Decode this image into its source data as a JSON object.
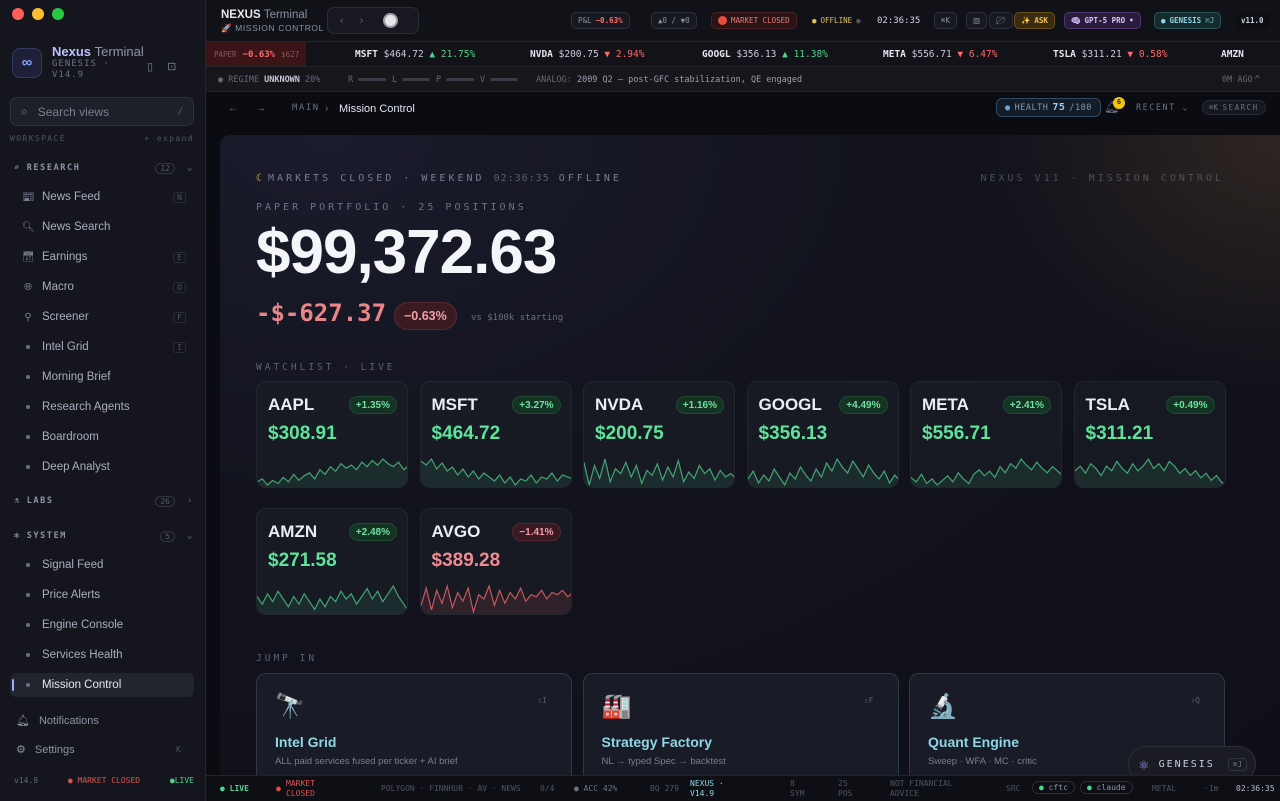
{
  "sidebar": {
    "brand_name": "Nexus",
    "brand_name2": "Terminal",
    "brand_sub1": "GENESIS ·",
    "brand_sub2": "V14.9",
    "search_placeholder": "Search views",
    "search_kbd": "/",
    "workspace_label": "WORKSPACE",
    "expand_label": "+ expand",
    "research": {
      "label": "RESEARCH",
      "count": "12"
    },
    "research_items": [
      {
        "label": "News Feed",
        "sc": "N"
      },
      {
        "label": "News Search",
        "sc": ""
      },
      {
        "label": "Earnings",
        "sc": "E"
      },
      {
        "label": "Macro",
        "sc": "O"
      },
      {
        "label": "Screener",
        "sc": "F"
      },
      {
        "label": "Intel Grid",
        "sc": "I"
      },
      {
        "label": "Morning Brief",
        "sc": ""
      },
      {
        "label": "Research Agents",
        "sc": ""
      },
      {
        "label": "Boardroom",
        "sc": ""
      },
      {
        "label": "Deep Analyst",
        "sc": ""
      }
    ],
    "labs": {
      "label": "LABS",
      "count": "26"
    },
    "system": {
      "label": "SYSTEM",
      "count": "5"
    },
    "system_items": [
      {
        "label": "Signal Feed"
      },
      {
        "label": "Price Alerts"
      },
      {
        "label": "Engine Console"
      },
      {
        "label": "Services Health"
      },
      {
        "label": "Mission Control"
      }
    ],
    "notifications": "Notifications",
    "settings": "Settings",
    "settings_sc": "K",
    "footer_version": "v14.9",
    "footer_market": "MARKET CLOSED",
    "footer_live": "LIVE"
  },
  "topbar": {
    "title": "NEXUS",
    "title2": "Terminal",
    "subtitle": "MISSION CONTROL",
    "pnl_label": "P&L",
    "pnl_value": "−0.63%",
    "counts": "▲0 / ▼0",
    "market": "MARKET CLOSED",
    "offline": "OFFLINE",
    "time": "02:36:35",
    "kbd": "⌘K",
    "ask": "ASK",
    "model": "GPT-5 PRO",
    "genesis": "GENESIS",
    "genesis_kbd": "⌘J",
    "version": "v11.0"
  },
  "ticker": {
    "paper_label": "PAPER",
    "paper_value": "−0.63%",
    "paper_amount": "$627",
    "items": [
      {
        "sym": "MSFT",
        "price": "$464.72",
        "chg": "▲ 21.75%",
        "dir": "up"
      },
      {
        "sym": "NVDA",
        "price": "$200.75",
        "chg": "▼ 2.94%",
        "dir": "dn"
      },
      {
        "sym": "GOOGL",
        "price": "$356.13",
        "chg": "▲ 11.38%",
        "dir": "up"
      },
      {
        "sym": "META",
        "price": "$556.71",
        "chg": "▼ 6.47%",
        "dir": "dn"
      },
      {
        "sym": "TSLA",
        "price": "$311.21",
        "chg": "▼ 0.58%",
        "dir": "dn"
      },
      {
        "sym": "AMZN",
        "price": "",
        "chg": "",
        "dir": "up"
      }
    ]
  },
  "regime": {
    "label": "REGIME",
    "value": "UNKNOWN",
    "pct": "20%",
    "r": "R",
    "l": "L",
    "p": "P",
    "v": "V",
    "analog_label": "ANALOG:",
    "analog": "2009 Q2 — post-GFC stabilization, QE engaged",
    "ago": "0M AGO"
  },
  "crumb": {
    "main": "MAIN",
    "sep": "›",
    "current": "Mission Control",
    "health_label": "HEALTH",
    "health_value": "75",
    "health_max": "/100",
    "bell_count": "6",
    "recent": "RECENT",
    "search_kbd": "⌘K",
    "search": "SEARCH"
  },
  "main": {
    "status": "MARKETS CLOSED · WEEKEND",
    "status_time": "02:36:35",
    "status_offline": "OFFLINE",
    "version": "NEXUS V11 · MISSION CONTROL",
    "portfolio_label": "PAPER PORTFOLIO · 25 POSITIONS",
    "portfolio_value": "$99,372.63",
    "pnl": "-$-627.37",
    "pnl_pct": "−0.63%",
    "vs": "vs $100k starting",
    "watchlist_label": "WATCHLIST · LIVE",
    "jump_label": "JUMP IN"
  },
  "watchlist": [
    {
      "sym": "AAPL",
      "chg": "+1.35%",
      "price": "$308.91",
      "dir": "up",
      "spark": [
        30,
        32,
        28,
        31,
        29,
        33,
        30,
        35,
        31,
        34,
        36,
        32,
        38,
        35,
        40,
        37,
        42,
        39,
        41,
        38,
        43,
        40,
        44,
        41,
        45,
        42,
        40,
        43,
        38,
        41
      ]
    },
    {
      "sym": "MSFT",
      "chg": "+3.27%",
      "price": "$464.72",
      "dir": "up",
      "spark": [
        38,
        36,
        39,
        34,
        37,
        33,
        35,
        31,
        34,
        30,
        33,
        29,
        32,
        30,
        28,
        31,
        27,
        30,
        26,
        29,
        28,
        31,
        27,
        30,
        29,
        32,
        28,
        31,
        30,
        29
      ]
    },
    {
      "sym": "NVDA",
      "chg": "+1.16%",
      "price": "$200.75",
      "dir": "up",
      "spark": [
        40,
        26,
        38,
        30,
        42,
        28,
        36,
        33,
        40,
        31,
        38,
        27,
        35,
        32,
        39,
        29,
        37,
        31,
        41,
        28,
        34,
        30,
        38,
        33,
        36,
        29,
        35,
        31,
        33,
        30
      ]
    },
    {
      "sym": "GOOGL",
      "chg": "+4.49%",
      "price": "$356.13",
      "dir": "up",
      "spark": [
        30,
        34,
        28,
        32,
        29,
        35,
        31,
        27,
        33,
        30,
        36,
        32,
        29,
        35,
        31,
        38,
        34,
        40,
        36,
        33,
        39,
        35,
        31,
        37,
        33,
        30,
        34,
        28,
        32,
        29
      ]
    },
    {
      "sym": "META",
      "chg": "+2.41%",
      "price": "$556.71",
      "dir": "up",
      "spark": [
        32,
        29,
        34,
        28,
        31,
        27,
        30,
        33,
        29,
        35,
        31,
        28,
        34,
        37,
        33,
        36,
        32,
        39,
        35,
        41,
        38,
        44,
        40,
        37,
        42,
        38,
        35,
        39,
        36,
        33
      ]
    },
    {
      "sym": "TSLA",
      "chg": "+0.49%",
      "price": "$311.21",
      "dir": "up",
      "spark": [
        36,
        38,
        35,
        39,
        37,
        34,
        38,
        36,
        40,
        37,
        35,
        39,
        36,
        38,
        41,
        37,
        39,
        36,
        40,
        38,
        35,
        37,
        34,
        36,
        33,
        35,
        32,
        34,
        31,
        30
      ]
    },
    {
      "sym": "AMZN",
      "chg": "+2.48%",
      "price": "$271.58",
      "dir": "up",
      "spark": [
        34,
        31,
        35,
        32,
        36,
        33,
        30,
        34,
        31,
        35,
        32,
        29,
        33,
        30,
        34,
        32,
        36,
        33,
        35,
        31,
        34,
        37,
        33,
        36,
        32,
        35,
        38,
        34,
        31,
        28
      ]
    },
    {
      "sym": "AVGO",
      "chg": "−1.41%",
      "price": "$389.28",
      "dir": "dn",
      "spark": [
        24,
        40,
        20,
        38,
        26,
        42,
        22,
        36,
        28,
        40,
        18,
        34,
        30,
        42,
        24,
        38,
        26,
        36,
        30,
        40,
        28,
        34,
        32,
        38,
        30,
        36,
        34,
        38,
        32,
        36
      ]
    }
  ],
  "jump": [
    {
      "emoji": "🔭",
      "title": "Intel Grid",
      "desc": "ALL paid services fused per ticker + AI brief",
      "key": "⇧I"
    },
    {
      "emoji": "🏭",
      "title": "Strategy Factory",
      "desc": "NL → typed Spec → backtest",
      "key": "⇧F"
    },
    {
      "emoji": "🔬",
      "title": "Quant Engine",
      "desc": "Sweep · WFA · MC · critic",
      "key": "⇧Q"
    }
  ],
  "genesis_btn": {
    "label": "GENESIS",
    "kbd": "⌘J"
  },
  "footer": {
    "live": "LIVE",
    "market1": "MARKET",
    "market2": "CLOSED",
    "sources": "POLYGON · FINNHUB · AV · NEWS",
    "src_count": "0/4",
    "acc": "ACC 42%",
    "bq": "BQ 279",
    "nexus1": "NEXUS ·",
    "nexus2": "V14.9",
    "sym_n": "8",
    "sym_l": "SYM",
    "pos_n": "25",
    "pos_l": "POS",
    "disc1": "NOT FINANCIAL",
    "disc2": "ADVICE",
    "src": "SRC",
    "cftc": "cftc",
    "claude": "claude",
    "metal": "METAL",
    "interval": "·1m",
    "time": "02:36:35"
  },
  "colors": {
    "up": "#52d18a",
    "down": "#ff6b6b",
    "accent": "#8fd6e6"
  }
}
